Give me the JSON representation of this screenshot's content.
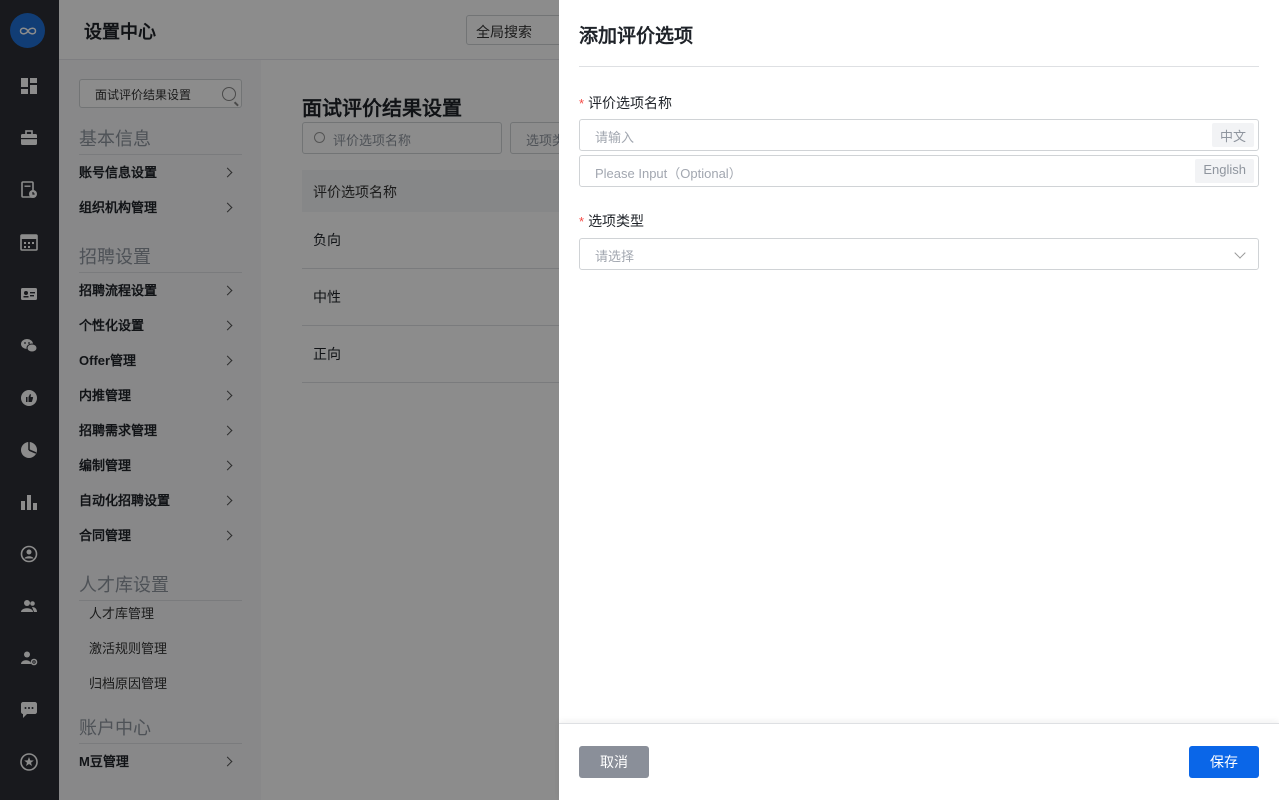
{
  "header": {
    "title": "设置中心",
    "global_search": "全局搜索"
  },
  "rail": {
    "logo_icon": "mokahr-logo-icon",
    "icons": [
      "dashboard-icon",
      "briefcase-icon",
      "document-clock-icon",
      "calendar-icon",
      "id-card-icon",
      "wechat-icon",
      "thumbs-up-icon",
      "pie-chart-icon",
      "bar-chart-icon",
      "person-circle-icon",
      "users-icon",
      "user-gear-icon",
      "chat-bubble-icon",
      "star-icon"
    ]
  },
  "sidebar": {
    "search_value": "面试评价结果设置",
    "groups": [
      {
        "title": "基本信息",
        "items": [
          "账号信息设置",
          "组织机构管理"
        ]
      },
      {
        "title": "招聘设置",
        "items": [
          "招聘流程设置",
          "个性化设置",
          "Offer管理",
          "内推管理",
          "招聘需求管理",
          "编制管理",
          "自动化招聘设置",
          "合同管理"
        ]
      },
      {
        "title": "人才库设置",
        "sub_items": [
          "人才库管理",
          "激活规则管理",
          "归档原因管理"
        ]
      },
      {
        "title": "账户中心",
        "items": [
          "M豆管理"
        ]
      }
    ]
  },
  "main": {
    "page_title": "面试评价结果设置",
    "filter_placeholder": "评价选项名称",
    "filter_select": "选项类",
    "table_header": "评价选项名称",
    "rows": [
      "负向",
      "中性",
      "正向"
    ]
  },
  "drawer": {
    "title": "添加评价选项",
    "name_label": "评价选项名称",
    "name_placeholder_cn": "请输入",
    "name_lang_cn": "中文",
    "name_placeholder_en": "Please Input（Optional）",
    "name_lang_en": "English",
    "type_label": "选项类型",
    "type_placeholder": "请选择",
    "required_mark": "*",
    "cancel_label": "取消",
    "save_label": "保存"
  },
  "colors": {
    "accent": "#0a66e8",
    "required": "#f54a45",
    "rail_bg": "#2c2f36"
  }
}
